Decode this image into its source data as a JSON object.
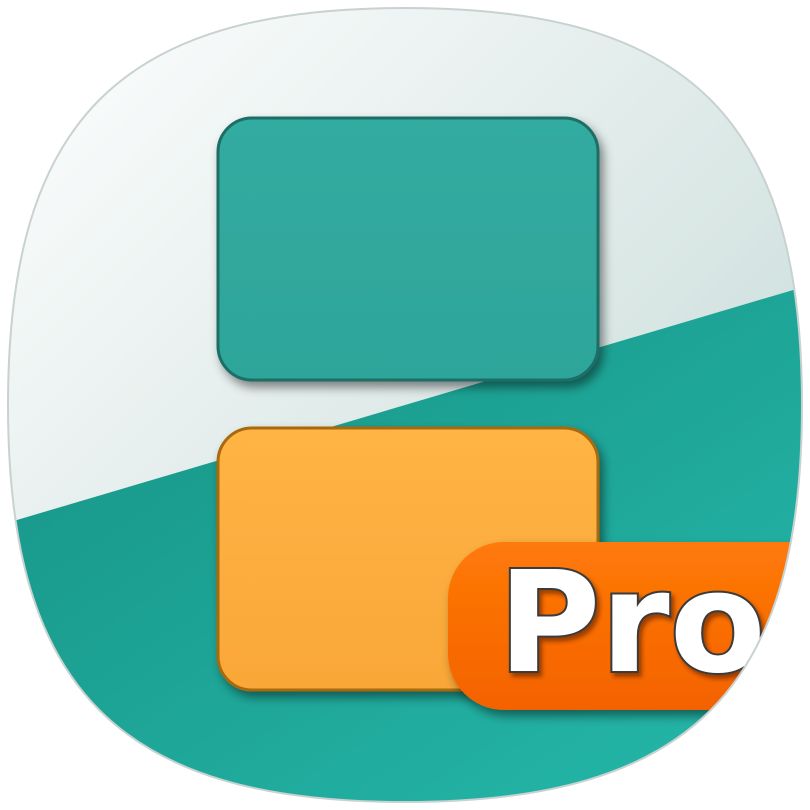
{
  "icon": {
    "badge_label": "Pro",
    "colors": {
      "background_light": "#e9efee",
      "background_teal": "#1f9a8c",
      "top_screen": "#2fa89d",
      "bottom_screen": "#fca93a",
      "badge": "#ff6a00",
      "badge_text": "#ffffff"
    },
    "symbols": [
      "dual-screen-icon",
      "pro-badge-icon"
    ]
  }
}
